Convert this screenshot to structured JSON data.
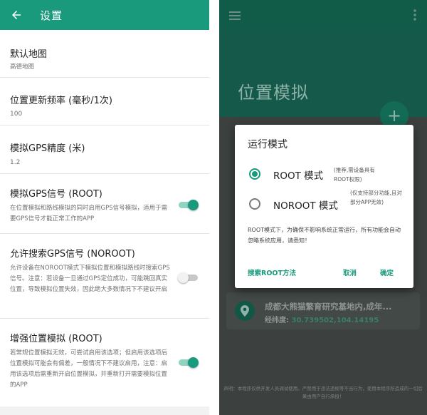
{
  "settings_screen": {
    "title": "设置",
    "back_icon": "arrow-left-icon",
    "colors": {
      "appbar": "#1a9a7d",
      "switch_on": "#1a9a7d",
      "switch_off": "#c8c8c8"
    },
    "preferences": [
      {
        "title": "默认地图",
        "summary": "高德地图"
      },
      {
        "title": "位置更新频率 (毫秒/1次)",
        "summary": "100"
      },
      {
        "title": "模拟GPS精度 (米)",
        "summary": "1.2"
      },
      {
        "title": "模拟GPS信号 (ROOT)",
        "summary": "在位置模拟和路线模拟的同时启用GPS信号模拟，适用于需要GPS信号才能正常工作的APP",
        "switch_on": true
      },
      {
        "title": "允许搜索GPS信号 (NOROOT)",
        "summary": "允许设备在NOROOT模式下模拟位置和模拟路线时搜索GPS信号。注意：若设备一旦通过GPS定位成功，可能跳回真实位置，导致模拟位置失效，因此绝大多数情况下不建议开启",
        "switch_on": false
      },
      {
        "title": "增强位置模拟 (ROOT)",
        "summary": "若常规位置模拟无效，可尝试启用该选项；但启用该选项后位置模拟可能会有偏差，一般情况下不建议启用，注意：启用该选项后需重新开启位置模拟，并重新打开需要模拟位置的APP",
        "switch_on": true
      }
    ]
  },
  "main_screen": {
    "menu_icon": "hamburger-menu-icon",
    "overflow_icon": "more-vert-icon",
    "title": "位置模拟",
    "fab_label": "+",
    "location": {
      "pin_icon": "location-pin-icon",
      "name": "成都大熊猫繁育研究基地内,成年...",
      "coord_label": "经纬度: ",
      "coord_value": "30.739502,104.14195"
    },
    "disclaimer": "声明：本程序仅供开发人员调试使用。严禁用于违法违规等不当行为，使用本程序所造成的一切后果由用户自行承担！",
    "dialog": {
      "title": "运行模式",
      "options": [
        {
          "label": "ROOT 模式",
          "note": "(推荐,需设备具有ROOT权限)",
          "selected": true
        },
        {
          "label": "NOROOT 模式",
          "note": "(仅支持部分功能,且对部分APP无效)",
          "selected": false
        }
      ],
      "message": "ROOT模式下，为确保不影响系统正常运行，所有功能会自动忽略系统应用，请悉知！",
      "search_button": "搜索ROOT方法",
      "cancel_button": "取消",
      "confirm_button": "确定"
    }
  }
}
